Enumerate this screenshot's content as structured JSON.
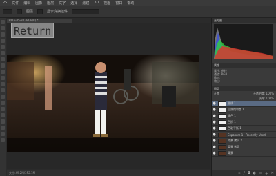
{
  "menubar": {
    "items": [
      "PS",
      "文件",
      "编辑",
      "图像",
      "图层",
      "文字",
      "选择",
      "滤镜",
      "3D",
      "视图",
      "窗口",
      "帮助"
    ]
  },
  "options": {
    "auto_select": "图层",
    "show_transform": "显示变换控件"
  },
  "document": {
    "tab_title": "2016-05-30 (RGB/8) *"
  },
  "overlay": {
    "return_label": "Return"
  },
  "status": {
    "text": "文档:49.2M/352.1M"
  },
  "dock": {
    "histogram_title": "直方图",
    "properties_title": "属性",
    "properties_rows": [
      "属性: 曲线",
      "通道: RGB",
      "输入:",
      "输出:"
    ],
    "layers_title": "图层",
    "blend_mode": "正常",
    "opacity": "不透明度: 100%",
    "fill": "填充: 100%",
    "layers": [
      {
        "name": "曲线 1",
        "thumb": "white",
        "selected": true
      },
      {
        "name": "自然饱和度 1",
        "thumb": "white",
        "selected": false
      },
      {
        "name": "颜色 1",
        "thumb": "white",
        "selected": false
      },
      {
        "name": "色阶 1",
        "thumb": "white",
        "selected": false
      },
      {
        "name": "色彩平衡 1",
        "thumb": "white",
        "selected": false
      },
      {
        "name": "Exposure 1 · Recently Used",
        "thumb": "dark",
        "selected": false
      },
      {
        "name": "背景 拷贝 2",
        "thumb": "dark",
        "selected": false
      },
      {
        "name": "背景 拷贝",
        "thumb": "dark",
        "selected": false
      },
      {
        "name": "背景",
        "thumb": "dark",
        "selected": false
      }
    ]
  }
}
